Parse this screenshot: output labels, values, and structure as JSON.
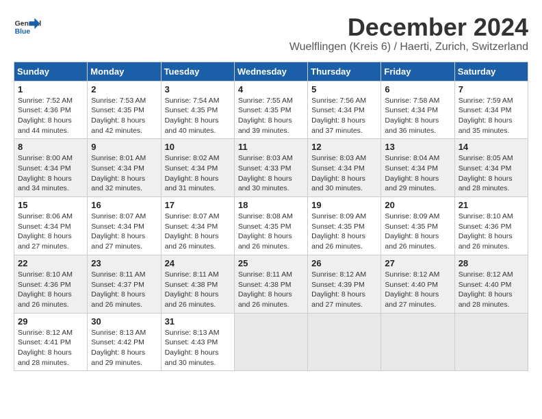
{
  "header": {
    "logo_general": "General",
    "logo_blue": "Blue",
    "month_title": "December 2024",
    "location": "Wuelflingen (Kreis 6) / Haerti, Zurich, Switzerland"
  },
  "days_of_week": [
    "Sunday",
    "Monday",
    "Tuesday",
    "Wednesday",
    "Thursday",
    "Friday",
    "Saturday"
  ],
  "weeks": [
    [
      {
        "day": "1",
        "sunrise": "7:52 AM",
        "sunset": "4:36 PM",
        "daylight": "8 hours and 44 minutes."
      },
      {
        "day": "2",
        "sunrise": "7:53 AM",
        "sunset": "4:35 PM",
        "daylight": "8 hours and 42 minutes."
      },
      {
        "day": "3",
        "sunrise": "7:54 AM",
        "sunset": "4:35 PM",
        "daylight": "8 hours and 40 minutes."
      },
      {
        "day": "4",
        "sunrise": "7:55 AM",
        "sunset": "4:35 PM",
        "daylight": "8 hours and 39 minutes."
      },
      {
        "day": "5",
        "sunrise": "7:56 AM",
        "sunset": "4:34 PM",
        "daylight": "8 hours and 37 minutes."
      },
      {
        "day": "6",
        "sunrise": "7:58 AM",
        "sunset": "4:34 PM",
        "daylight": "8 hours and 36 minutes."
      },
      {
        "day": "7",
        "sunrise": "7:59 AM",
        "sunset": "4:34 PM",
        "daylight": "8 hours and 35 minutes."
      }
    ],
    [
      {
        "day": "8",
        "sunrise": "8:00 AM",
        "sunset": "4:34 PM",
        "daylight": "8 hours and 34 minutes."
      },
      {
        "day": "9",
        "sunrise": "8:01 AM",
        "sunset": "4:34 PM",
        "daylight": "8 hours and 32 minutes."
      },
      {
        "day": "10",
        "sunrise": "8:02 AM",
        "sunset": "4:34 PM",
        "daylight": "8 hours and 31 minutes."
      },
      {
        "day": "11",
        "sunrise": "8:03 AM",
        "sunset": "4:33 PM",
        "daylight": "8 hours and 30 minutes."
      },
      {
        "day": "12",
        "sunrise": "8:03 AM",
        "sunset": "4:34 PM",
        "daylight": "8 hours and 30 minutes."
      },
      {
        "day": "13",
        "sunrise": "8:04 AM",
        "sunset": "4:34 PM",
        "daylight": "8 hours and 29 minutes."
      },
      {
        "day": "14",
        "sunrise": "8:05 AM",
        "sunset": "4:34 PM",
        "daylight": "8 hours and 28 minutes."
      }
    ],
    [
      {
        "day": "15",
        "sunrise": "8:06 AM",
        "sunset": "4:34 PM",
        "daylight": "8 hours and 27 minutes."
      },
      {
        "day": "16",
        "sunrise": "8:07 AM",
        "sunset": "4:34 PM",
        "daylight": "8 hours and 27 minutes."
      },
      {
        "day": "17",
        "sunrise": "8:07 AM",
        "sunset": "4:34 PM",
        "daylight": "8 hours and 26 minutes."
      },
      {
        "day": "18",
        "sunrise": "8:08 AM",
        "sunset": "4:35 PM",
        "daylight": "8 hours and 26 minutes."
      },
      {
        "day": "19",
        "sunrise": "8:09 AM",
        "sunset": "4:35 PM",
        "daylight": "8 hours and 26 minutes."
      },
      {
        "day": "20",
        "sunrise": "8:09 AM",
        "sunset": "4:35 PM",
        "daylight": "8 hours and 26 minutes."
      },
      {
        "day": "21",
        "sunrise": "8:10 AM",
        "sunset": "4:36 PM",
        "daylight": "8 hours and 26 minutes."
      }
    ],
    [
      {
        "day": "22",
        "sunrise": "8:10 AM",
        "sunset": "4:36 PM",
        "daylight": "8 hours and 26 minutes."
      },
      {
        "day": "23",
        "sunrise": "8:11 AM",
        "sunset": "4:37 PM",
        "daylight": "8 hours and 26 minutes."
      },
      {
        "day": "24",
        "sunrise": "8:11 AM",
        "sunset": "4:38 PM",
        "daylight": "8 hours and 26 minutes."
      },
      {
        "day": "25",
        "sunrise": "8:11 AM",
        "sunset": "4:38 PM",
        "daylight": "8 hours and 26 minutes."
      },
      {
        "day": "26",
        "sunrise": "8:12 AM",
        "sunset": "4:39 PM",
        "daylight": "8 hours and 27 minutes."
      },
      {
        "day": "27",
        "sunrise": "8:12 AM",
        "sunset": "4:40 PM",
        "daylight": "8 hours and 27 minutes."
      },
      {
        "day": "28",
        "sunrise": "8:12 AM",
        "sunset": "4:40 PM",
        "daylight": "8 hours and 28 minutes."
      }
    ],
    [
      {
        "day": "29",
        "sunrise": "8:12 AM",
        "sunset": "4:41 PM",
        "daylight": "8 hours and 28 minutes."
      },
      {
        "day": "30",
        "sunrise": "8:13 AM",
        "sunset": "4:42 PM",
        "daylight": "8 hours and 29 minutes."
      },
      {
        "day": "31",
        "sunrise": "8:13 AM",
        "sunset": "4:43 PM",
        "daylight": "8 hours and 30 minutes."
      },
      null,
      null,
      null,
      null
    ]
  ],
  "labels": {
    "sunrise": "Sunrise:",
    "sunset": "Sunset:",
    "daylight": "Daylight:"
  }
}
